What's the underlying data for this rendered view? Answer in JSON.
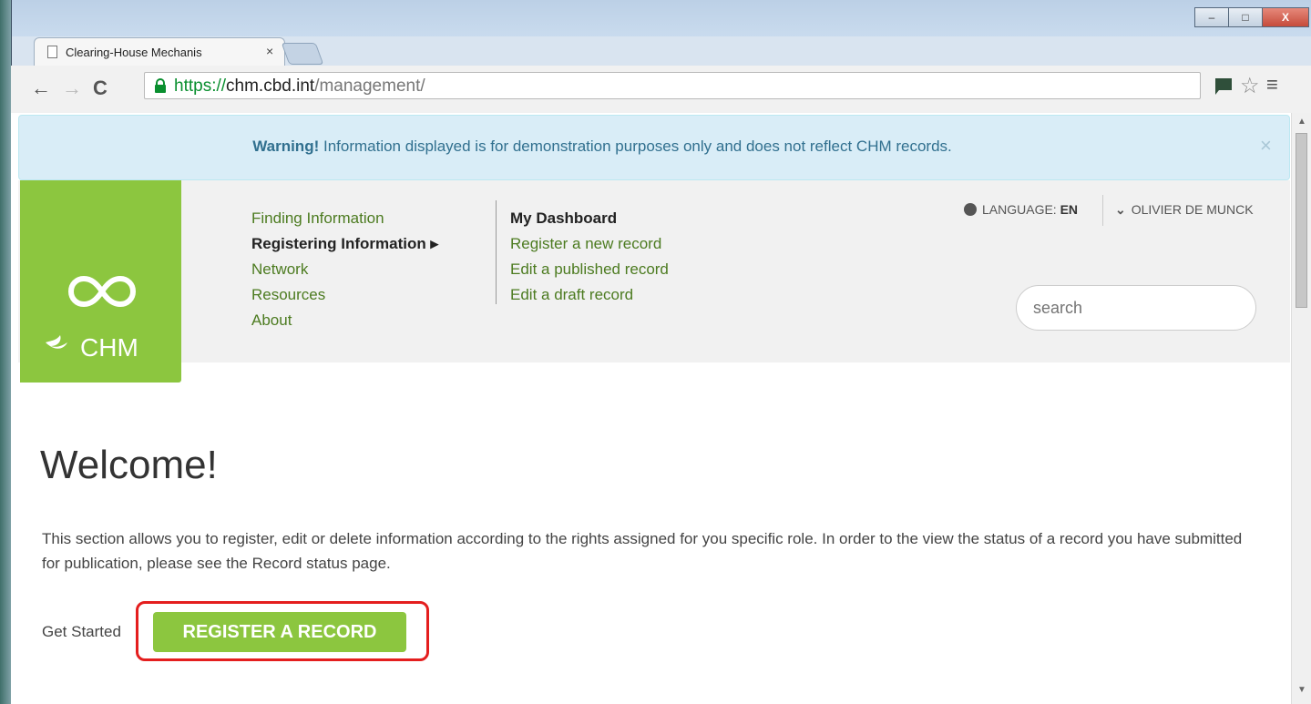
{
  "browser": {
    "tab_title": "Clearing-House Mechanis",
    "tab_close": "×",
    "url_protocol": "https://",
    "url_host": "chm.cbd.int",
    "url_path": "/management/",
    "window_buttons": {
      "minimize": "–",
      "maximize": "□",
      "close": "X"
    }
  },
  "alert": {
    "strong": "Warning!",
    "message": " Information displayed is for demonstration purposes only and does not reflect CHM records.",
    "close": "×"
  },
  "logo": {
    "text": "CHM",
    "color": "#8cc63f"
  },
  "nav": {
    "items": [
      {
        "label": "Finding Information"
      },
      {
        "label": "Registering Information ▸"
      },
      {
        "label": "Network"
      },
      {
        "label": "Resources"
      },
      {
        "label": "About"
      }
    ],
    "active_index": 1
  },
  "submenu": {
    "title": "My Dashboard",
    "items": [
      "Register a new record",
      "Edit a published record",
      "Edit a draft record"
    ]
  },
  "header_right": {
    "language_label": "LANGUAGE: ",
    "language_value": "EN",
    "user": "OLIVIER DE MUNCK",
    "search_placeholder": "search"
  },
  "main": {
    "heading": "Welcome!",
    "intro": "This section allows you to register, edit or delete information according to the rights assigned for you specific role. In order to the view the status of a record you have submitted for publication, please see the Record status page.",
    "get_started": "Get Started",
    "register_button": "REGISTER A RECORD"
  },
  "colors": {
    "accent": "#8cc63f",
    "highlight": "#e41e1e",
    "alert_bg": "#d9edf7"
  }
}
